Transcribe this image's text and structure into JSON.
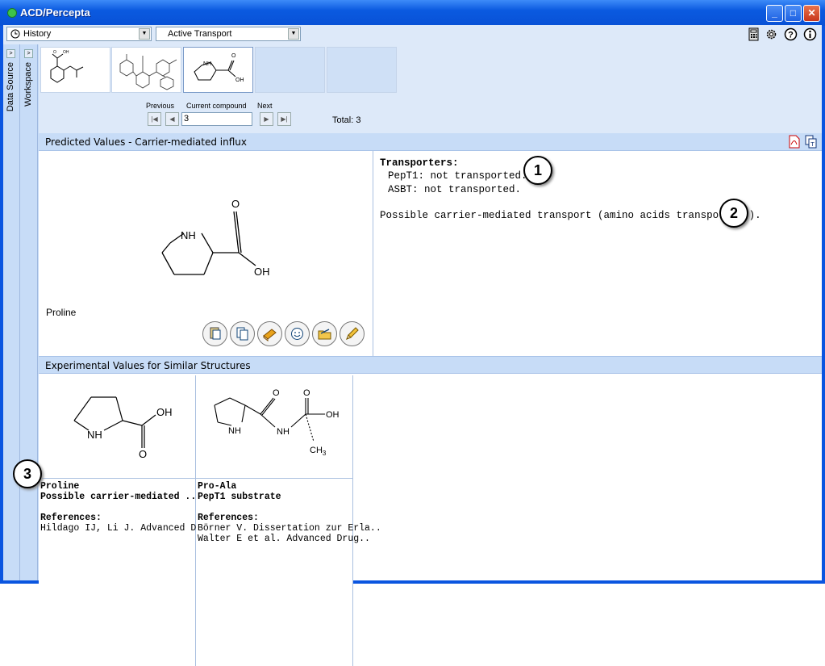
{
  "window": {
    "title": "ACD/Percepta"
  },
  "toolbar": {
    "history_label": "History",
    "module_label": "Active Transport",
    "icons": [
      "calculator-icon",
      "gear-icon",
      "help-icon",
      "info-icon"
    ]
  },
  "sidebars": {
    "data_source": "Data Source",
    "workspace": "Workspace"
  },
  "navigator": {
    "previous_label": "Previous",
    "current_label": "Current compound",
    "next_label": "Next",
    "current_value": "3",
    "total": "Total: 3"
  },
  "predicted": {
    "section_title": "Predicted Values - Carrier-mediated influx",
    "compound_name": "Proline",
    "transporters_heading": "Transporters:",
    "transporters": [
      "PepT1: not transported.",
      "ASBT: not transported."
    ],
    "possible_transport": "Possible carrier-mediated transport (amino acids transporters).",
    "structure_labels": {
      "nh": "NH",
      "o": "O",
      "oh": "OH"
    }
  },
  "callouts": [
    "1",
    "2",
    "3"
  ],
  "experimental": {
    "section_title": "Experimental Values for Similar Structures",
    "cards": [
      {
        "name": "Proline",
        "subtitle": "Possible carrier-mediated ..",
        "references_label": "References:",
        "refs": [
          "Hildago IJ, Li J. Advanced Dru.."
        ],
        "labels": {
          "nh": "NH",
          "o": "O",
          "oh": "OH"
        }
      },
      {
        "name": "Pro-Ala",
        "subtitle": "PepT1 substrate",
        "references_label": "References:",
        "refs": [
          "Börner V. Dissertation zur Erla..",
          "Walter E et al. Advanced Drug.."
        ],
        "labels": {
          "nh1": "NH",
          "nh2": "NH",
          "o1": "O",
          "o2": "O",
          "oh": "OH",
          "ch3": "CH",
          "sub3": "3"
        }
      }
    ]
  },
  "thumbnails": {
    "t1_o": "O",
    "t1_oh": "OH",
    "t3_nh": "NH",
    "t3_o": "O",
    "t3_oh": "OH"
  },
  "colors": {
    "title_bar": "#0b5ae0",
    "panel_header": "#c7dcf7",
    "background": "#dde9f9"
  }
}
